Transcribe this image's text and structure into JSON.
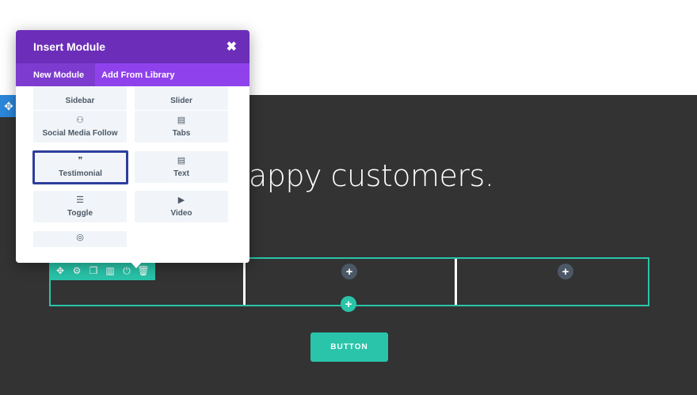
{
  "page": {
    "hero_text": "appy customers.",
    "cta_label": "BUTTON"
  },
  "colors": {
    "dark_bg": "#333333",
    "accent_green": "#29c4a9",
    "modal_purple": "#6c2eb9",
    "tab_purple": "#8f42ec",
    "selection_border": "#2d3e9b",
    "handle_blue": "#2b87da"
  },
  "modal": {
    "title": "Insert Module",
    "close_symbol": "✖",
    "tabs": [
      {
        "label": "New Module",
        "active": true
      },
      {
        "label": "Add From Library",
        "active": false
      }
    ],
    "modules": [
      {
        "label": "Sidebar",
        "icon": "sidebar-icon",
        "glyph": ""
      },
      {
        "label": "Slider",
        "icon": "slider-icon",
        "glyph": ""
      },
      {
        "label": "Social Media Follow",
        "icon": "social-follow-icon",
        "glyph": "⚇"
      },
      {
        "label": "Tabs",
        "icon": "tabs-icon",
        "glyph": "▤"
      },
      {
        "label": "Testimonial",
        "icon": "quote-icon",
        "glyph": "❞",
        "selected": true
      },
      {
        "label": "Text",
        "icon": "text-icon",
        "glyph": "▤"
      },
      {
        "label": "Toggle",
        "icon": "toggle-icon",
        "glyph": "☰"
      },
      {
        "label": "Video",
        "icon": "video-icon",
        "glyph": "▶"
      },
      {
        "label": "",
        "icon": "camera-icon",
        "glyph": "◎"
      }
    ]
  },
  "row_toolbar": {
    "icons": [
      {
        "name": "move-icon",
        "glyph": "✥"
      },
      {
        "name": "gear-icon",
        "glyph": "⚙"
      },
      {
        "name": "duplicate-icon",
        "glyph": "❐"
      },
      {
        "name": "columns-icon",
        "glyph": "▥"
      },
      {
        "name": "power-icon",
        "glyph": "⏻"
      },
      {
        "name": "trash-icon",
        "glyph": "🗑"
      }
    ]
  },
  "add_symbol": "+",
  "move_symbol": "✥"
}
